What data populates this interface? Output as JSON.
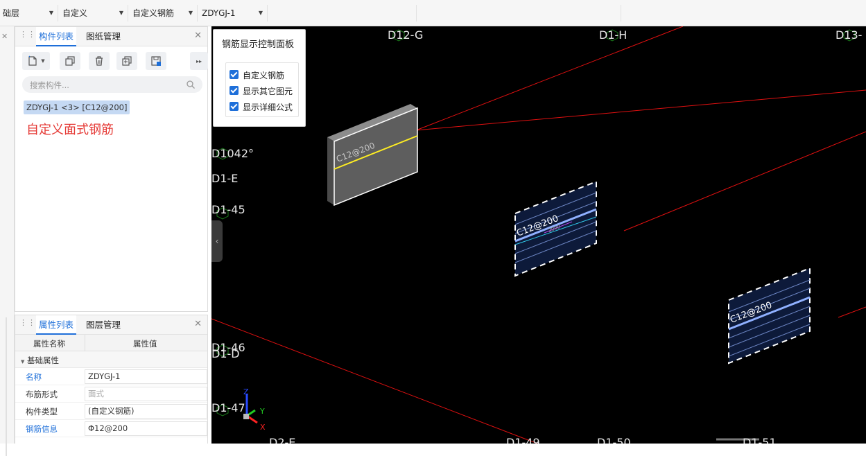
{
  "toolbar": {
    "floor": "础层",
    "category": "自定义",
    "type": "自定义钢筋",
    "component": "ZDYGJ-1"
  },
  "component_panel": {
    "tab_components": "构件列表",
    "tab_drawings": "图纸管理",
    "search_placeholder": "搜索构件...",
    "selected_item": "ZDYGJ-1 <3> [C12@200]",
    "note": "自定义面式钢筋"
  },
  "property_panel": {
    "tab_properties": "属性列表",
    "tab_layers": "图层管理",
    "col_name": "属性名称",
    "col_value": "属性值",
    "group": "基础属性",
    "rows": [
      {
        "key": "名称",
        "value": "ZDYGJ-1"
      },
      {
        "key": "布筋形式",
        "value": "面式"
      },
      {
        "key": "构件类型",
        "value": "(自定义钢筋)"
      },
      {
        "key": "钢筋信息",
        "value": "Φ12@200"
      }
    ]
  },
  "control_panel": {
    "title": "钢筋显示控制面板",
    "options": [
      {
        "label": "自定义钢筋",
        "checked": true
      },
      {
        "label": "显示其它图元",
        "checked": true
      },
      {
        "label": "显示详细公式",
        "checked": true
      }
    ]
  },
  "viewport": {
    "axis_labels": {
      "d1g": "D12-G",
      "d1h": "D1-H",
      "d13": "D13-",
      "d1e_top": "D1042°",
      "d1e": "D1-E",
      "d145": "D1-45",
      "d146": "D1-46",
      "d1d": "D1-D",
      "d147": "D1-47",
      "d2e": "D2-E",
      "d149": "D1-49",
      "d150": "D1-50",
      "d151": "D1-51"
    },
    "rebar_labels": {
      "slab1": "C12@200",
      "slab2": "C12@200",
      "slab3": "C12@200",
      "slab2_small": "2000"
    },
    "gizmo": {
      "z": "Z",
      "y": "Y",
      "x": "X"
    }
  }
}
